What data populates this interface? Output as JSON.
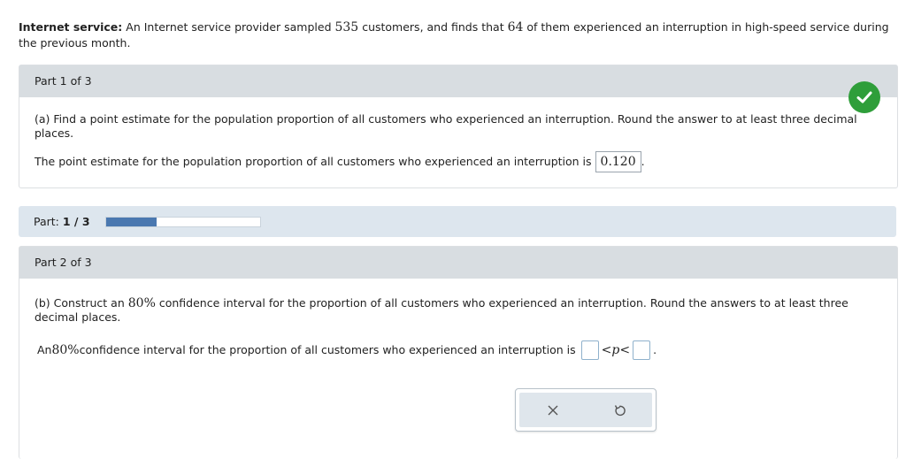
{
  "problem": {
    "heading": "Internet service:",
    "text_1": "An Internet service provider sampled ",
    "sample_size": "535",
    "text_2": " customers, and finds that ",
    "count": "64",
    "text_3": " of them experienced an interruption in high-speed service during the previous month."
  },
  "part1": {
    "header": "Part 1 of 3",
    "question": "(a) Find a point estimate for the population proportion of all customers who experienced an interruption. Round the answer to at least three decimal places.",
    "answer_prefix": "The point estimate for the population proportion of all customers who experienced an interruption is",
    "answer_value": "0.120",
    "answer_suffix": "."
  },
  "progress": {
    "label": "Part:",
    "value_text": "1 / 3",
    "fraction": 0.333
  },
  "part2": {
    "header": "Part 2 of 3",
    "question_1": "(b) Construct an ",
    "confidence": "80%",
    "question_2": " confidence interval for the proportion of all customers who experienced an interruption. Round the answers to at least three decimal places.",
    "answer_1": "An ",
    "answer_2": " confidence interval for the proportion of all customers who experienced an interruption is",
    "inequality": "<p<",
    "answer_suffix": "."
  },
  "toolbar": {
    "clear_icon": "close-icon",
    "undo_icon": "undo-icon"
  },
  "colors": {
    "check": "#2f9e3a",
    "progress_fill": "#4a78b0",
    "header_bg": "#d8dde1"
  }
}
